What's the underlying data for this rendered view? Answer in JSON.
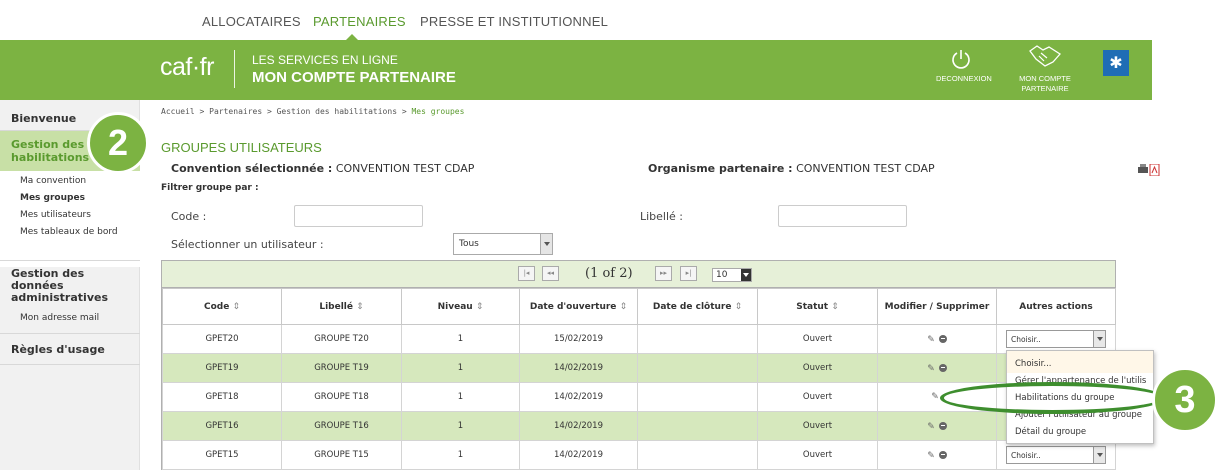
{
  "topnav": {
    "items": [
      {
        "label": "ALLOCATAIRES"
      },
      {
        "label": "PARTENAIRES"
      },
      {
        "label": "PRESSE ET INSTITUTIONNEL"
      }
    ]
  },
  "header": {
    "logo": "caf·fr",
    "subtitle": "LES SERVICES EN LIGNE",
    "title": "MON COMPTE PARTENAIRE",
    "logout_label": "DECONNEXION",
    "account_label_1": "MON COMPTE",
    "account_label_2": "PARTENAIRE",
    "colors": {
      "green": "#7cb342",
      "blue": "#1f6db5"
    }
  },
  "sidebar": {
    "welcome": "Bienvenue",
    "section1": "Gestion des habilitations",
    "section1_items": [
      "Ma convention",
      "Mes groupes",
      "Mes utilisateurs",
      "Mes tableaux de bord"
    ],
    "section2": "Gestion des données administratives",
    "section2_items": [
      "Mon adresse mail"
    ],
    "rules": "Règles d'usage"
  },
  "badges": {
    "first": "2",
    "second": "3"
  },
  "breadcrumb": {
    "path": "Accueil > Partenaires > Gestion des habilitations > ",
    "current": "Mes groupes"
  },
  "main": {
    "title": "GROUPES UTILISATEURS",
    "convention_label": "Convention sélectionnée :",
    "convention_value": "CONVENTION TEST CDAP",
    "organism_label": "Organisme partenaire :",
    "organism_value": "CONVENTION TEST CDAP",
    "filter_title": "Filtrer groupe par :",
    "code_label": "Code :",
    "code_value": "",
    "libelle_label": "Libellé :",
    "libelle_value": "",
    "user_label": "Sélectionner un utilisateur :",
    "user_value": "Tous"
  },
  "pager": {
    "status": "(1 of 2)",
    "rows_per_page": "10",
    "first": "⏮",
    "prev": "«",
    "next": "»",
    "last": "⏭"
  },
  "table": {
    "columns": [
      "Code",
      "Libellé",
      "Niveau",
      "Date d'ouverture",
      "Date de clôture",
      "Statut",
      "Modifier / Supprimer",
      "Autres actions"
    ],
    "sort_icon": "⇕",
    "rows": [
      {
        "code": "GPET20",
        "libelle": "GROUPE T20",
        "niveau": "1",
        "ouverture": "15/02/2019",
        "cloture": "",
        "statut": "Ouvert",
        "action": "Choisir..",
        "delete": true
      },
      {
        "code": "GPET19",
        "libelle": "GROUPE T19",
        "niveau": "1",
        "ouverture": "14/02/2019",
        "cloture": "",
        "statut": "Ouvert",
        "action": "",
        "delete": true
      },
      {
        "code": "GPET18",
        "libelle": "GROUPE T18",
        "niveau": "1",
        "ouverture": "14/02/2019",
        "cloture": "",
        "statut": "Ouvert",
        "action": "",
        "delete": false
      },
      {
        "code": "GPET16",
        "libelle": "GROUPE T16",
        "niveau": "1",
        "ouverture": "14/02/2019",
        "cloture": "",
        "statut": "Ouvert",
        "action": "",
        "delete": true
      },
      {
        "code": "GPET15",
        "libelle": "GROUPE T15",
        "niveau": "1",
        "ouverture": "14/02/2019",
        "cloture": "",
        "statut": "Ouvert",
        "action": "Choisir..",
        "delete": true
      }
    ]
  },
  "dropdown": {
    "options": [
      "Choisir...",
      "Gérer l'appartenance de l'utilis",
      "Habilitations du groupe",
      "Ajouter l'utilisateur au groupe",
      "Détail du groupe"
    ]
  }
}
